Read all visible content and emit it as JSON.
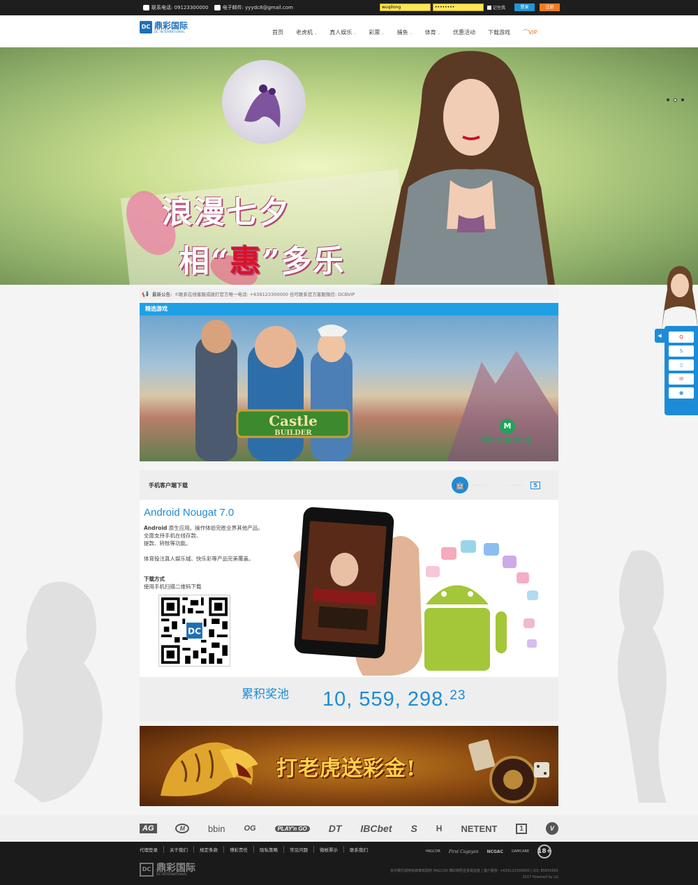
{
  "topbar": {
    "phone_label": "联系电话: 09123300000",
    "email_label": "电子邮件: yyydc8@gmail.com",
    "username_value": "wuqilong",
    "password_value": "••••••••",
    "remember_label": "记住我",
    "login_label": "登录",
    "register_label": "注册"
  },
  "header": {
    "logo_mark": "DC",
    "logo_cn": "鼎彩国际",
    "logo_en": "DC INTERNATIONAL",
    "nav": [
      {
        "label": "首页"
      },
      {
        "label": "老虎机"
      },
      {
        "label": "真人娱乐"
      },
      {
        "label": "彩票"
      },
      {
        "label": "捕鱼"
      },
      {
        "label": "体育"
      },
      {
        "label": "优惠活动"
      },
      {
        "label": "下载游戏"
      },
      {
        "label": "VIP"
      }
    ]
  },
  "banner": {
    "line1": "浪漫七夕",
    "line2_pre": "相“",
    "line2_hl": "惠",
    "line2_post": "”多乐"
  },
  "ticker": {
    "label": "最新公告:",
    "text": "①联系在线客服或拨打官方唯一电话: +639123300000 也可联系官方客服微信: DCBVIP"
  },
  "featured": {
    "title": "精选游戏",
    "game_name_line1": "Castle",
    "game_name_line2": "BUILDER",
    "provider": "Microgaming",
    "provider_mark": "M"
  },
  "mobile": {
    "title": "手机客户端下载",
    "version": "Android Nougat 7.0",
    "desc_bold": "Android",
    "desc_rest": " 原生应用。操作体验完胜业界其他产品。",
    "desc_line2": "全面支持手机在线存款、",
    "desc_line3": "提款、转账等功能。",
    "desc_line4": "体育投注真人娱乐城、快乐彩等产品完美覆盖。",
    "dl_title": "下载方式",
    "dl_sub": "使用手机扫描二维码下载",
    "platform_android": "🤖",
    "platform_apple": "",
    "platform_html5": "5",
    "sep": "······",
    "qr_center": "DC"
  },
  "jackpot": {
    "label": "累积奖池",
    "amount_main": "10, 559, 298.",
    "amount_cents": "23"
  },
  "tiger": {
    "text": "打老虎送彩金!"
  },
  "service": {
    "tab": "◀",
    "rows": [
      "Q",
      "S",
      "▯",
      "✉",
      "●"
    ]
  },
  "partners": [
    "AG",
    "M",
    "bbin",
    "OG",
    "PLAY'n GO",
    "DT",
    "IBCbet",
    "S",
    "H",
    "NETENT",
    "1",
    "V"
  ],
  "footer": {
    "links": [
      "代理登录",
      "关于我们",
      "规定条款",
      "博彩责任",
      "隐私策略",
      "常见问题",
      "微帐票示",
      "联系我们"
    ],
    "logo_mark": "DC",
    "logo_cn": "鼎彩国际",
    "logo_en": "DC INTERNATIONAL",
    "certs": [
      "PAGCOR",
      "First Cagayan",
      "NCGAC",
      "GAMCARE",
      "18+"
    ],
    "copy_line1": "多乐娱乐城持有菲律宾政府 PAGCOR 博彩牌照且受其监管 | 客户服务: +639123300000 | QQ: 85655665",
    "copy_line2": "2017 Powered by LG"
  }
}
